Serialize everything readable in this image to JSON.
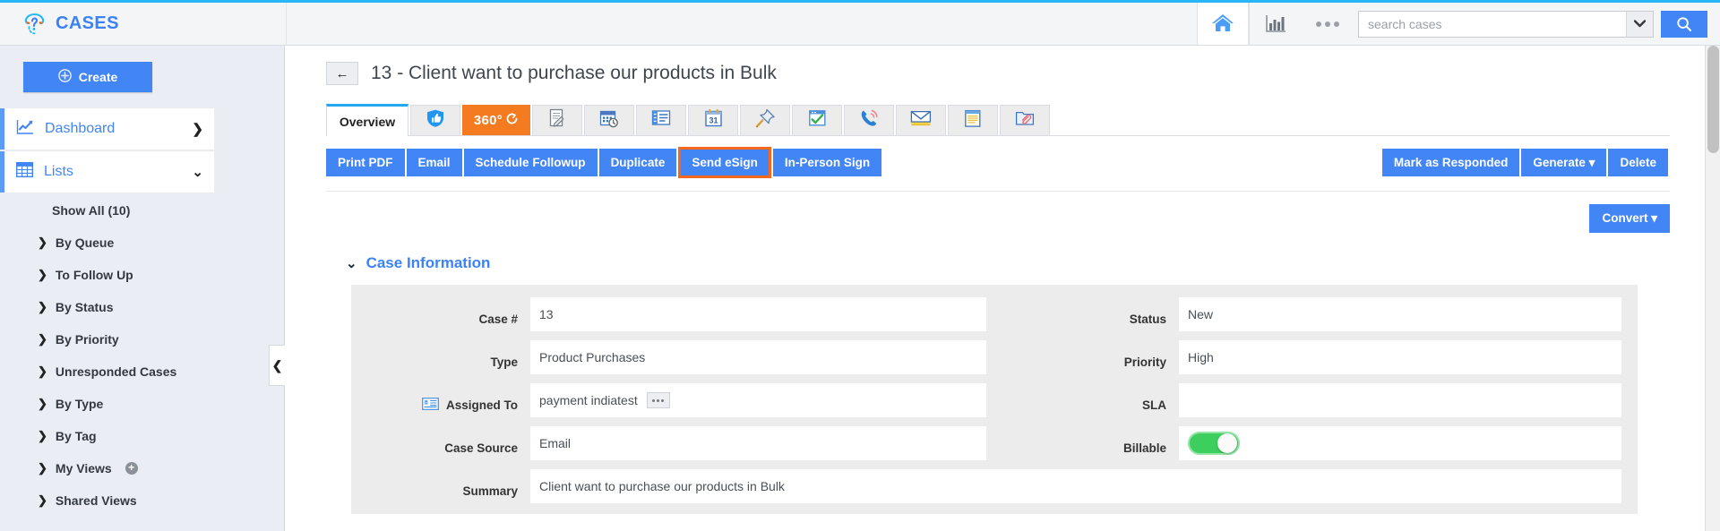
{
  "header": {
    "brand": "CASES",
    "brand_icon": "question-mark-headphone-logo",
    "home_icon": "home-icon",
    "reports_icon": "bar-chart-icon",
    "more_icon": "more-dots-icon",
    "search": {
      "placeholder": "search cases",
      "value": "",
      "caret_icon": "chevron-down-icon",
      "go_icon": "search-icon"
    }
  },
  "sidebar": {
    "create_label": "Create",
    "create_icon": "plus-circle-icon",
    "nav": [
      {
        "label": "Dashboard",
        "icon": "chart-line-icon",
        "chevron": "❯"
      },
      {
        "label": "Lists",
        "icon": "grid-table-icon",
        "chevron": "❯"
      }
    ],
    "items": [
      {
        "label": "Show All (10)",
        "chevron": ""
      },
      {
        "label": "By Queue",
        "chevron": "❯"
      },
      {
        "label": "To Follow Up",
        "chevron": "❯"
      },
      {
        "label": "By Status",
        "chevron": "❯"
      },
      {
        "label": "By Priority",
        "chevron": "❯"
      },
      {
        "label": "Unresponded Cases",
        "chevron": "❯"
      },
      {
        "label": "By Type",
        "chevron": "❯"
      },
      {
        "label": "By Tag",
        "chevron": "❯"
      },
      {
        "label": "My Views",
        "chevron": "❯",
        "badge": "+"
      },
      {
        "label": "Shared Views",
        "chevron": "❯"
      }
    ],
    "collapse_icon": "❮"
  },
  "main": {
    "back_icon": "←",
    "page_title": "13 - Client want to purchase our products in Bulk",
    "tabs": [
      {
        "label": "Overview",
        "icon": "",
        "type": "active"
      },
      {
        "label": "",
        "icon": "shield-thumbsup-icon",
        "type": "icon"
      },
      {
        "label": "360°",
        "icon": "refresh-icon",
        "type": "orange"
      },
      {
        "label": "",
        "icon": "note-edit-icon",
        "type": "icon"
      },
      {
        "label": "",
        "icon": "calendar-clock-icon",
        "type": "icon"
      },
      {
        "label": "",
        "icon": "list-card-icon",
        "type": "icon"
      },
      {
        "label": "",
        "icon": "calendar-31-icon",
        "type": "icon"
      },
      {
        "label": "",
        "icon": "pushpin-icon",
        "type": "icon"
      },
      {
        "label": "",
        "icon": "task-check-icon",
        "type": "icon"
      },
      {
        "label": "",
        "icon": "phone-call-icon",
        "type": "icon"
      },
      {
        "label": "",
        "icon": "envelope-icon",
        "type": "icon"
      },
      {
        "label": "",
        "icon": "notes-icon",
        "type": "icon"
      },
      {
        "label": "",
        "icon": "attachment-folder-icon",
        "type": "icon"
      }
    ],
    "actions_left": [
      {
        "label": "Print PDF",
        "highlighted": false
      },
      {
        "label": "Email",
        "highlighted": false
      },
      {
        "label": "Schedule Followup",
        "highlighted": false
      },
      {
        "label": "Duplicate",
        "highlighted": false
      },
      {
        "label": "Send eSign",
        "highlighted": true
      },
      {
        "label": "In-Person Sign",
        "highlighted": false
      }
    ],
    "actions_right": [
      {
        "label": "Mark as Responded"
      },
      {
        "label": "Generate ▾"
      },
      {
        "label": "Delete"
      }
    ],
    "convert_label": "Convert ▾",
    "section": {
      "chevron": "⌄",
      "title": "Case Information"
    },
    "fields_left": [
      {
        "label": "Case #",
        "value": "13",
        "icon": ""
      },
      {
        "label": "Type",
        "value": "Product Purchases",
        "icon": ""
      },
      {
        "label": "Assigned To",
        "value": "payment indiatest",
        "icon": "contact-card-icon",
        "has_picker": true
      },
      {
        "label": "Case Source",
        "value": "Email",
        "icon": ""
      }
    ],
    "fields_right": [
      {
        "label": "Status",
        "value": "New",
        "type": "text"
      },
      {
        "label": "Priority",
        "value": "High",
        "type": "text"
      },
      {
        "label": "SLA",
        "value": "",
        "type": "text"
      },
      {
        "label": "Billable",
        "value": "on",
        "type": "toggle"
      }
    ],
    "summary": {
      "label": "Summary",
      "value": "Client want to purchase our products in Bulk"
    }
  },
  "colors": {
    "accent_blue": "#4285f4",
    "brand_blue": "#3b82f6",
    "orange": "#f47b20",
    "highlight_orange": "#f4671c",
    "toggle_green": "#3ccf5d",
    "sidebar_bg": "#eaeef4",
    "panel_bg": "#ececec",
    "top_accent": "#29b6f6"
  }
}
